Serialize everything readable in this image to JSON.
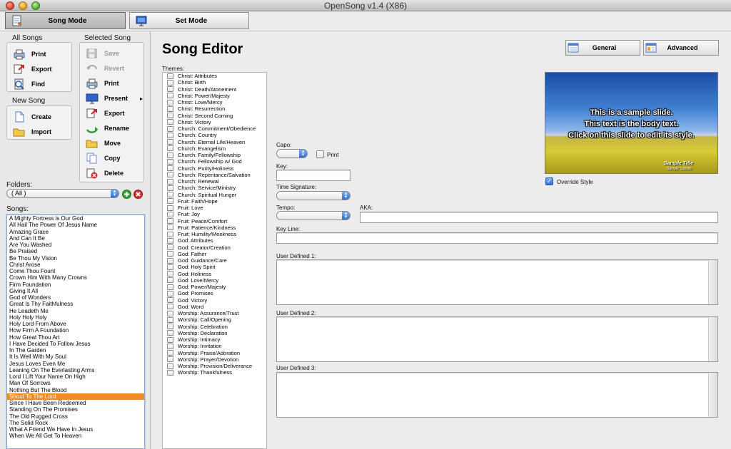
{
  "window": {
    "title": "OpenSong v1.4 (X86)"
  },
  "modes": {
    "song_mode": "Song Mode",
    "set_mode": "Set Mode"
  },
  "all_songs": {
    "label": "All Songs",
    "items": [
      {
        "label": "Print",
        "icon": "printer-icon"
      },
      {
        "label": "Export",
        "icon": "export-icon"
      },
      {
        "label": "Find",
        "icon": "find-icon"
      }
    ]
  },
  "new_song": {
    "label": "New Song",
    "items": [
      {
        "label": "Create",
        "icon": "new-document-icon"
      },
      {
        "label": "Import",
        "icon": "folder-open-icon"
      }
    ]
  },
  "selected_song": {
    "label": "Selected Song",
    "items": [
      {
        "label": "Save",
        "disabled": true
      },
      {
        "label": "Revert",
        "disabled": true
      },
      {
        "label": "Print",
        "disabled": false
      },
      {
        "label": "Present",
        "disabled": false
      },
      {
        "label": "Export",
        "disabled": false
      },
      {
        "label": "Rename",
        "disabled": false
      },
      {
        "label": "Move",
        "disabled": false
      },
      {
        "label": "Copy",
        "disabled": false
      },
      {
        "label": "Delete",
        "disabled": false
      }
    ],
    "present_submenu_arrow": "▸"
  },
  "folders": {
    "label": "Folders:",
    "value": "( All )"
  },
  "songs": {
    "label": "Songs:",
    "selected_index": 27,
    "items": [
      "A Mighty Fortress is Our God",
      "All Hail The Power Of Jesus Name",
      "Amazing Grace",
      "And Can It Be",
      "Are You Washed",
      "Be Praised",
      "Be Thou My Vision",
      "Christ Arose",
      "Come Thou Fount",
      "Crown Him With Many Crowns",
      "Firm Foundation",
      "Giving It All",
      "God of Wonders",
      "Great Is Thy Faithfulness",
      "He Leadeth Me",
      "Holy Holy Holy",
      "Holy Lord From Above",
      "How Firm A Foundation",
      "How Great Thou Art",
      "I Have Decided To Follow Jesus",
      "In The Garden",
      "It Is Well With My Soul",
      "Jesus Loves Even Me",
      "Leaning On The Everlasting Arms",
      "Lord I Lift Your Name On High",
      "Man Of Sorrows",
      "Nothing But The Blood",
      "Shout To The Lord",
      "Since I Have Been Redeemed",
      "Standing On The Promises",
      "The Old Rugged Cross",
      "The Solid Rock",
      "What A Friend We Have In Jesus",
      "When We All Get To Heaven"
    ]
  },
  "editor": {
    "heading": "Song Editor",
    "tabs": {
      "general": "General",
      "advanced": "Advanced"
    },
    "themes_label": "Themes:",
    "themes": [
      "Christ: Attributes",
      "Christ: Birth",
      "Christ: Death/Atonement",
      "Christ: Power/Majesty",
      "Christ: Love/Mercy",
      "Christ: Resurrection",
      "Christ: Second Coming",
      "Christ: Victory",
      "Church: Commitment/Obedience",
      "Church: Country",
      "Church: Eternal Life/Heaven",
      "Church: Evangelism",
      "Church: Family/Fellowship",
      "Church: Fellowship w/ God",
      "Church: Purity/Holiness",
      "Church: Repentance/Salvation",
      "Church: Renewal",
      "Church: Service/Ministry",
      "Church: Spiritual Hunger",
      "Fruit: Faith/Hope",
      "Fruit: Love",
      "Fruit: Joy",
      "Fruit: Peace/Comfort",
      "Fruit: Patience/Kindness",
      "Fruit: Humility/Meekness",
      "God: Attributes",
      "God: Creator/Creation",
      "God: Father",
      "God: Guidance/Care",
      "God: Holy Spirit",
      "God: Holiness",
      "God: Love/Mercy",
      "God: Power/Majesty",
      "God: Promises",
      "God: Victory",
      "God: Word",
      "Worship: Assurance/Trust",
      "Worship: Call/Opening",
      "Worship: Celebration",
      "Worship: Declaration",
      "Worship: Intimacy",
      "Worship: Invitation",
      "Worship: Praise/Adoration",
      "Worship: Prayer/Devotion",
      "Worship: Provision/Deliverance",
      "Worship: Thankfulness"
    ],
    "capo_label": "Capo:",
    "capo_print_label": "Print",
    "key_label": "Key:",
    "time_signature_label": "Time Signature:",
    "tempo_label": "Tempo:",
    "aka_label": "AKA:",
    "key_line_label": "Key Line:",
    "user_defined_1_label": "User Defined 1:",
    "user_defined_2_label": "User Defined 2:",
    "user_defined_3_label": "User Defined 3:",
    "override_style_label": "Override Style",
    "override_style_checked": true
  },
  "preview": {
    "line1": "This is a sample slide.",
    "line2": "This text is the body text.",
    "line3": "Click on this slide to edit its style.",
    "title": "Sample Title",
    "subtitle": "Sample Subtitle"
  }
}
